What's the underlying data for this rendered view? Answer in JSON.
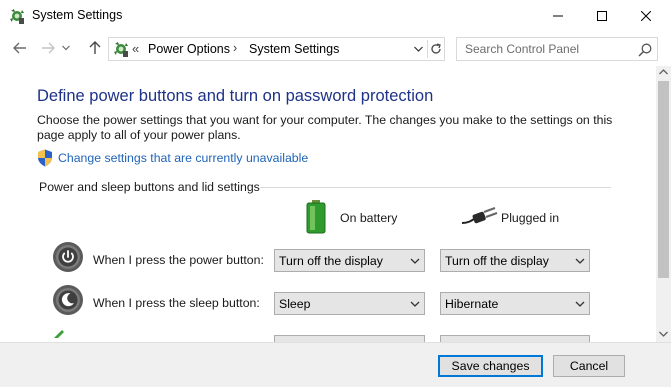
{
  "window": {
    "title": "System Settings",
    "icon": "power-options-icon",
    "controls": [
      "minimize",
      "maximize",
      "close"
    ]
  },
  "nav": {
    "breadcrumb_prefix": "«",
    "breadcrumbs": [
      "Power Options",
      "System Settings"
    ],
    "separator": "›",
    "search_placeholder": "Search Control Panel"
  },
  "main": {
    "heading": "Define power buttons and turn on password protection",
    "description": "Choose the power settings that you want for your computer. The changes you make to the settings on this page apply to all of your power plans.",
    "change_settings_link": "Change settings that are currently unavailable",
    "section_title": "Power and sleep buttons and lid settings",
    "columns": {
      "battery": "On battery",
      "plugged": "Plugged in"
    },
    "rows": [
      {
        "label": "When I press the power button:",
        "on_battery": "Turn off the display",
        "plugged_in": "Turn off the display",
        "icon": "power-button-icon"
      },
      {
        "label": "When I press the sleep button:",
        "on_battery": "Sleep",
        "plugged_in": "Hibernate",
        "icon": "sleep-button-icon"
      }
    ]
  },
  "footer": {
    "save_label": "Save changes",
    "cancel_label": "Cancel"
  },
  "colors": {
    "heading": "#1e3287",
    "link": "#1f64b8",
    "accent": "#0078d7",
    "footer_bg": "#f0f0f0"
  }
}
